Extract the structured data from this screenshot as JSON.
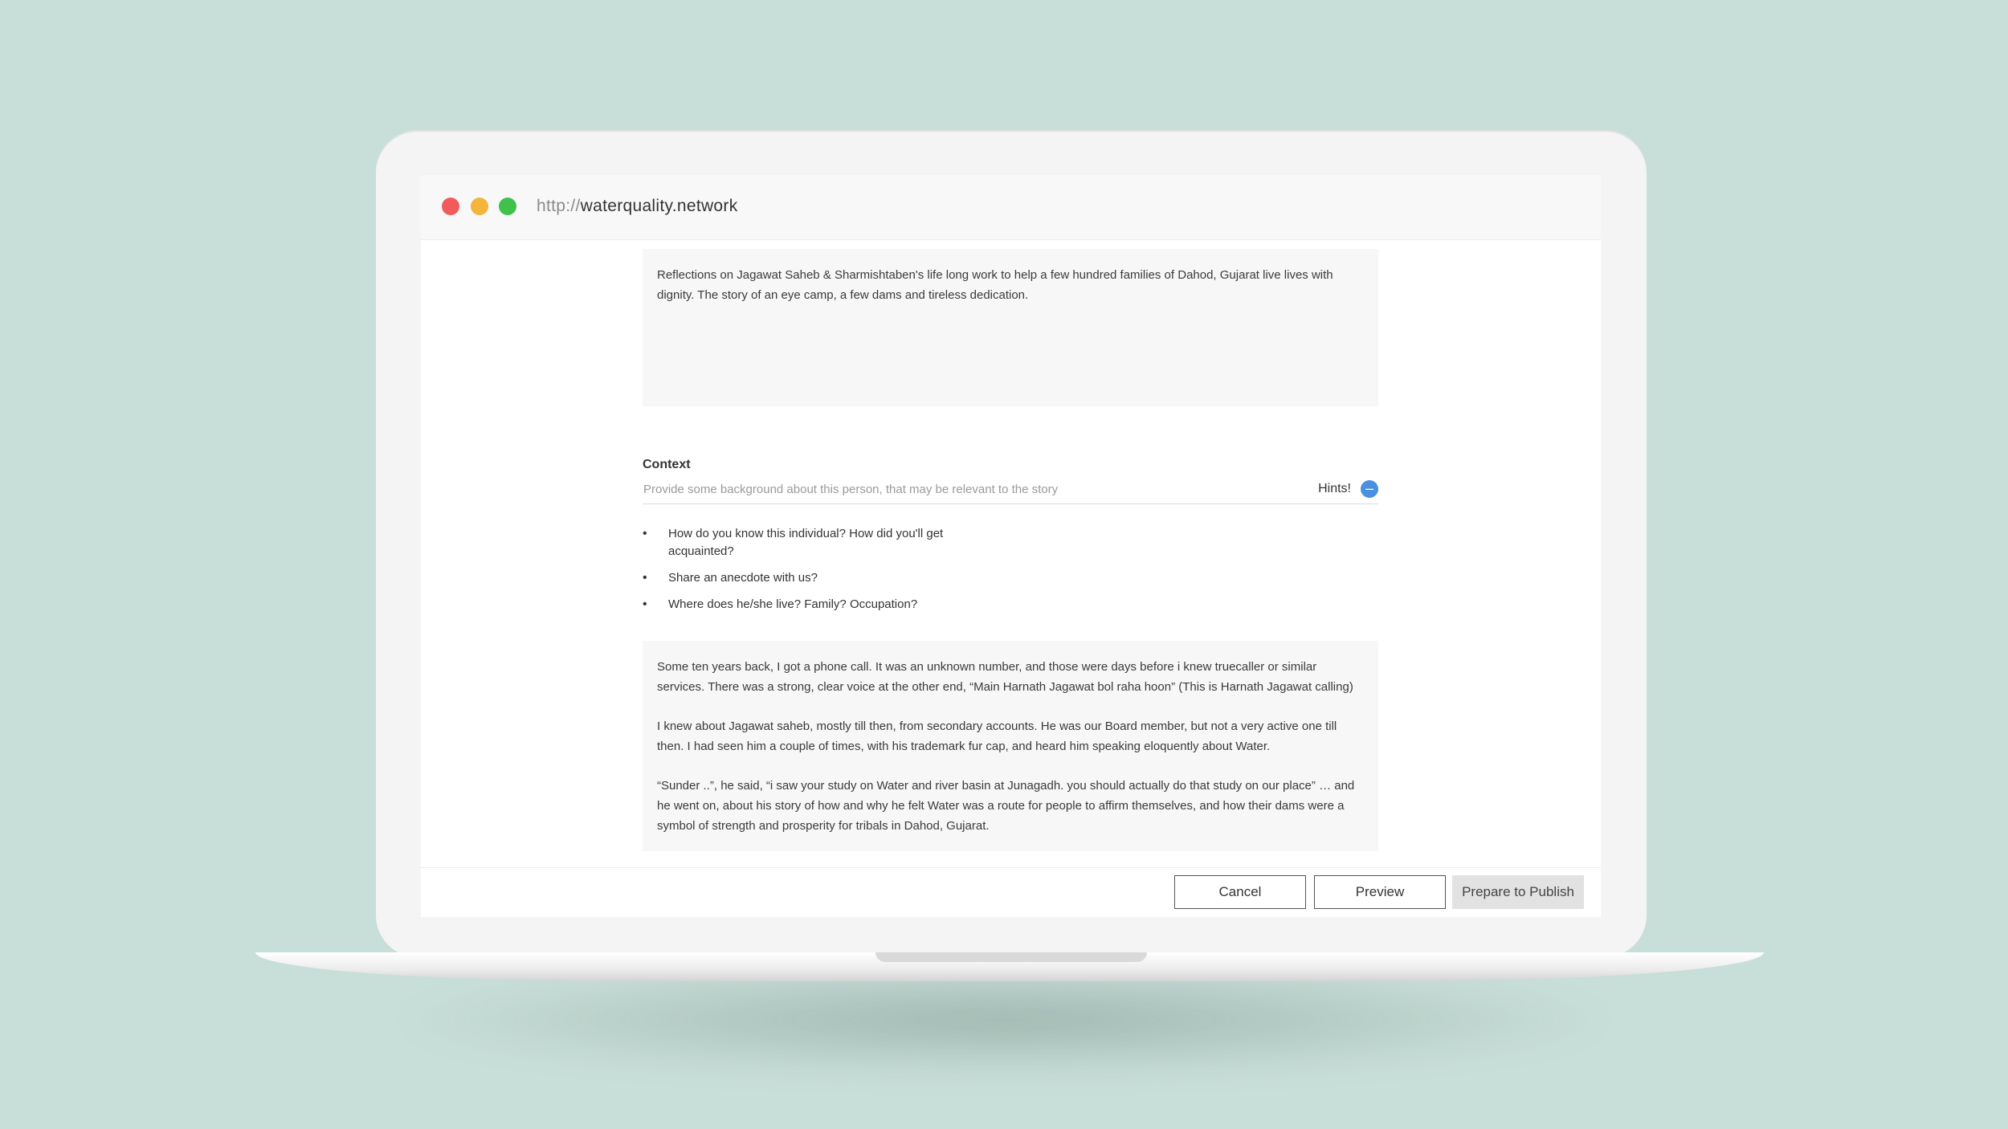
{
  "browser": {
    "url_protocol": "http://",
    "url_host": "waterquality.network"
  },
  "form": {
    "summary_text": "Reflections on Jagawat Saheb & Sharmishtaben's life long work to help a few hundred families of Dahod, Gujarat live lives with dignity. The story of an eye camp, a few dams and tireless dedication.",
    "context": {
      "label": "Context",
      "placeholder": "Provide some background about this person, that may be relevant to the story",
      "hints_label": "Hints!",
      "hints_toggle_icon": "minus-circle-icon",
      "hints": [
        "How do you know this individual? How did you'll get acquainted?",
        "Share an anecdote with us?",
        "Where does he/she live? Family? Occupation?"
      ]
    },
    "story_paragraphs": [
      "Some ten years back, I got a phone call. It was an unknown number, and those were days before i knew truecaller or similar services. There was a strong, clear voice at the other end, “Main Harnath Jagawat bol raha hoon” (This is Harnath Jagawat calling)",
      "I knew about Jagawat saheb, mostly till then, from secondary accounts. He was our Board member, but not a very active one till then. I had seen him a couple of times, with his trademark fur cap, and heard him speaking eloquently about Water.",
      "“Sunder ..”, he said, “i saw your study on Water and river basin at Junagadh. you should actually do that study on our place” … and he went on, about his story of how and why he felt Water was a route for people to affirm themselves, and how their dams were a symbol of strength and prosperity for tribals in Dahod, Gujarat."
    ]
  },
  "actions": {
    "cancel_label": "Cancel",
    "preview_label": "Preview",
    "publish_label": "Prepare to Publish"
  },
  "colors": {
    "background": "#c8ded8",
    "accent": "#4a8fe0",
    "traffic_red": "#f15b5b",
    "traffic_yellow": "#f5b43a",
    "traffic_green": "#3fc14c"
  }
}
